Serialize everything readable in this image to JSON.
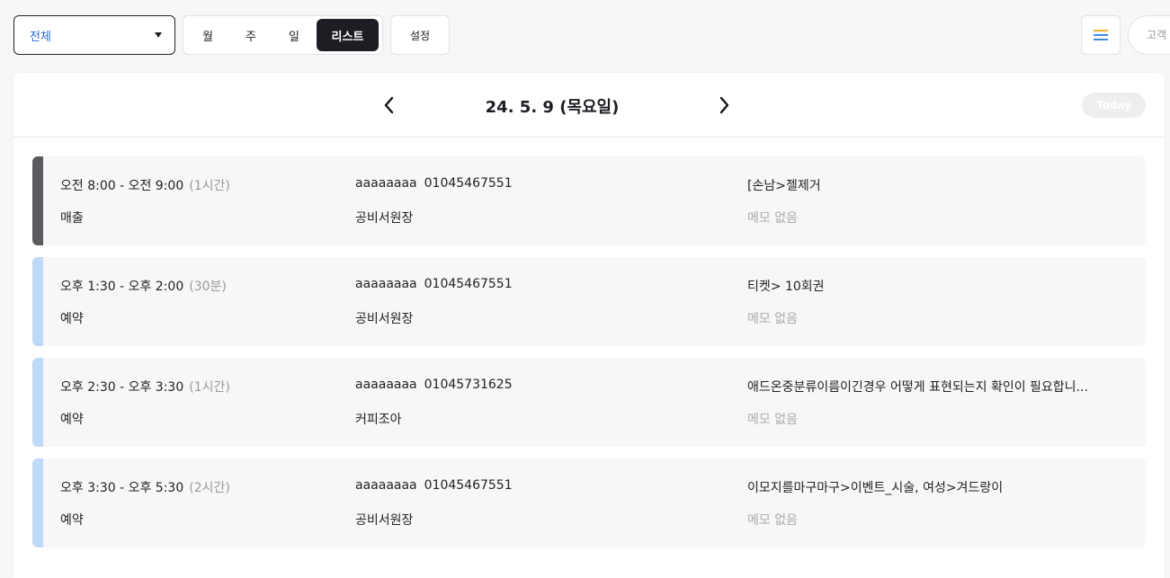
{
  "filter": {
    "selected": "전체"
  },
  "view_tabs": [
    "월",
    "주",
    "일",
    "리스트"
  ],
  "active_view": "리스트",
  "settings_label": "설정",
  "customer_button_label": "고객",
  "date_label": "24. 5. 9 (목요일)",
  "today_label": "Today",
  "colors": {
    "accent_dark": "#1c1e23",
    "sales_bar": "#5a5a5f",
    "reservation_bar": "#bfdaf7",
    "filter_text": "#2a6bd6"
  },
  "icons": {
    "prev": "chevron-left-icon",
    "next": "chevron-right-icon",
    "menu": "hamburger-menu-icon"
  },
  "appointments": [
    {
      "time": "오전 8:00 - 오전 9:00",
      "duration": "(1시간)",
      "type": "매출",
      "customer": "aaaaaaaa",
      "phone": "01045467551",
      "staff": "공비서원장",
      "service": "[손남>젤제거",
      "memo": "메모 없음",
      "bar_color": "#5a5a5f"
    },
    {
      "time": "오후 1:30 - 오후 2:00",
      "duration": "(30분)",
      "type": "예약",
      "customer": "aaaaaaaa",
      "phone": "01045467551",
      "staff": "공비서원장",
      "service": "티켓> 10회권",
      "memo": "메모 없음",
      "bar_color": "#bfdaf7"
    },
    {
      "time": "오후 2:30 - 오후 3:30",
      "duration": "(1시간)",
      "type": "예약",
      "customer": "aaaaaaaa",
      "phone": "01045731625",
      "staff": "커피조아",
      "service": "애드온중분류이름이긴경우 어떻게 표현되는지 확인이 필요합니...",
      "memo": "메모 없음",
      "bar_color": "#bfdaf7"
    },
    {
      "time": "오후 3:30 - 오후 5:30",
      "duration": "(2시간)",
      "type": "예약",
      "customer": "aaaaaaaa",
      "phone": "01045467551",
      "staff": "공비서원장",
      "service": "이모지를마구마구>이벤트_시술, 여성>겨드랑이",
      "memo": "메모 없음",
      "bar_color": "#bfdaf7"
    }
  ]
}
